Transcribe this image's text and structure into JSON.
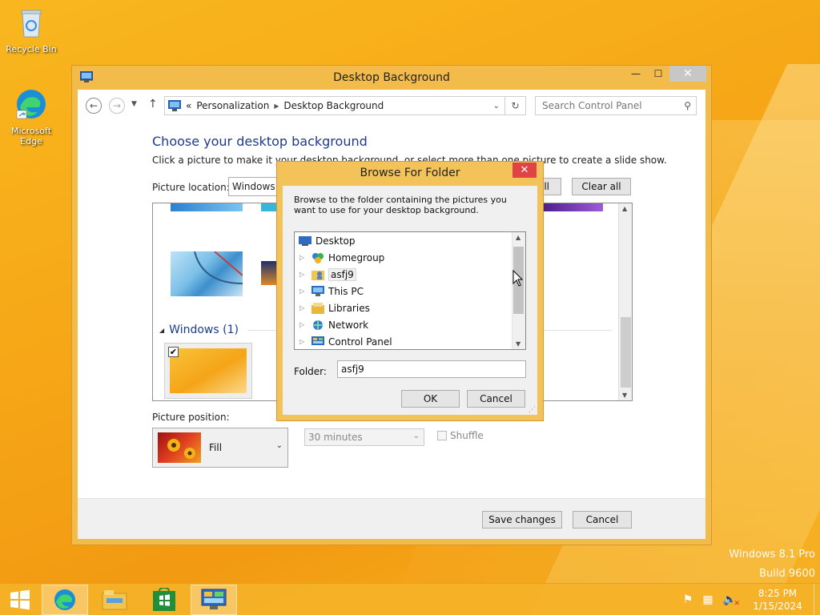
{
  "desktop": {
    "icons": [
      {
        "label": "Recycle Bin"
      },
      {
        "label": "Microsoft Edge"
      }
    ],
    "watermark": [
      "Windows 8.1 Pro",
      "Build 9600"
    ]
  },
  "window": {
    "title": "Desktop Background",
    "address": {
      "chevron": "«",
      "crumbs": [
        "Personalization",
        "Desktop Background"
      ]
    },
    "search_placeholder": "Search Control Panel",
    "heading": "Choose your desktop background",
    "subtext": "Click a picture to make it your desktop background, or select more than one picture to create a slide show.",
    "picture_location_label": "Picture location:",
    "picture_location_value": "Windows D",
    "select_all_label": "all",
    "clear_all_label": "Clear all",
    "group_header": "Windows (1)",
    "picture_position_label": "Picture position:",
    "picture_position_value": "Fill",
    "interval_value": "30 minutes",
    "shuffle_label": "Shuffle",
    "save_label": "Save changes",
    "cancel_label": "Cancel"
  },
  "dialog": {
    "title": "Browse For Folder",
    "description": "Browse to the folder containing the pictures you want to use for your desktop background.",
    "tree": [
      {
        "label": "Desktop",
        "icon": "desktop-icon"
      },
      {
        "label": "Homegroup",
        "icon": "homegroup-icon"
      },
      {
        "label": "asfj9",
        "icon": "user-folder-icon",
        "selected": true
      },
      {
        "label": "This PC",
        "icon": "computer-icon"
      },
      {
        "label": "Libraries",
        "icon": "libraries-icon"
      },
      {
        "label": "Network",
        "icon": "network-icon"
      },
      {
        "label": "Control Panel",
        "icon": "control-panel-icon"
      }
    ],
    "folder_label": "Folder:",
    "folder_value": "asfj9",
    "ok_label": "OK",
    "cancel_label": "Cancel"
  },
  "taskbar": {
    "time": "8:25 PM",
    "date": "1/15/2024"
  }
}
